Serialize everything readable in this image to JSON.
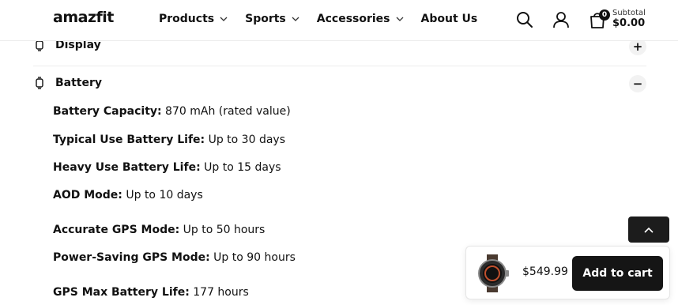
{
  "header": {
    "logo": "amazfit",
    "nav": [
      {
        "label": "Products",
        "has_dropdown": true
      },
      {
        "label": "Sports",
        "has_dropdown": true
      },
      {
        "label": "Accessories",
        "has_dropdown": true
      },
      {
        "label": "About Us",
        "has_dropdown": false
      }
    ],
    "cart_count": "0",
    "subtotal_label": "Subtotal",
    "subtotal_value": "$0.00",
    "icons": [
      "search-icon",
      "user-icon",
      "shopping-bag-icon"
    ]
  },
  "accordion": {
    "display_title": "Display",
    "display_toggle": "+",
    "battery_title": "Battery",
    "battery_toggle": "−"
  },
  "specs": [
    {
      "label": "Battery Capacity:",
      "value": " 870 mAh (rated value)"
    },
    {
      "label": "Typical Use Battery Life:",
      "value": " Up to 30 days"
    },
    {
      "label": "Heavy Use Battery Life:",
      "value": " Up to 15 days"
    },
    {
      "label": "AOD Mode:",
      "value": " Up to 10 days"
    },
    {
      "label": "Accurate GPS Mode:",
      "value": " Up to 50 hours"
    },
    {
      "label": "Power-Saving GPS Mode:",
      "value": " Up to 90 hours"
    },
    {
      "label": "GPS Max Battery Life:",
      "value": " 177 hours"
    }
  ],
  "sticky_cart": {
    "price": "$549.99",
    "button_label": "Add to cart"
  },
  "colors": {
    "accent": "#151515",
    "divider": "#ececec",
    "toggle_bg": "#f2f2f2"
  }
}
